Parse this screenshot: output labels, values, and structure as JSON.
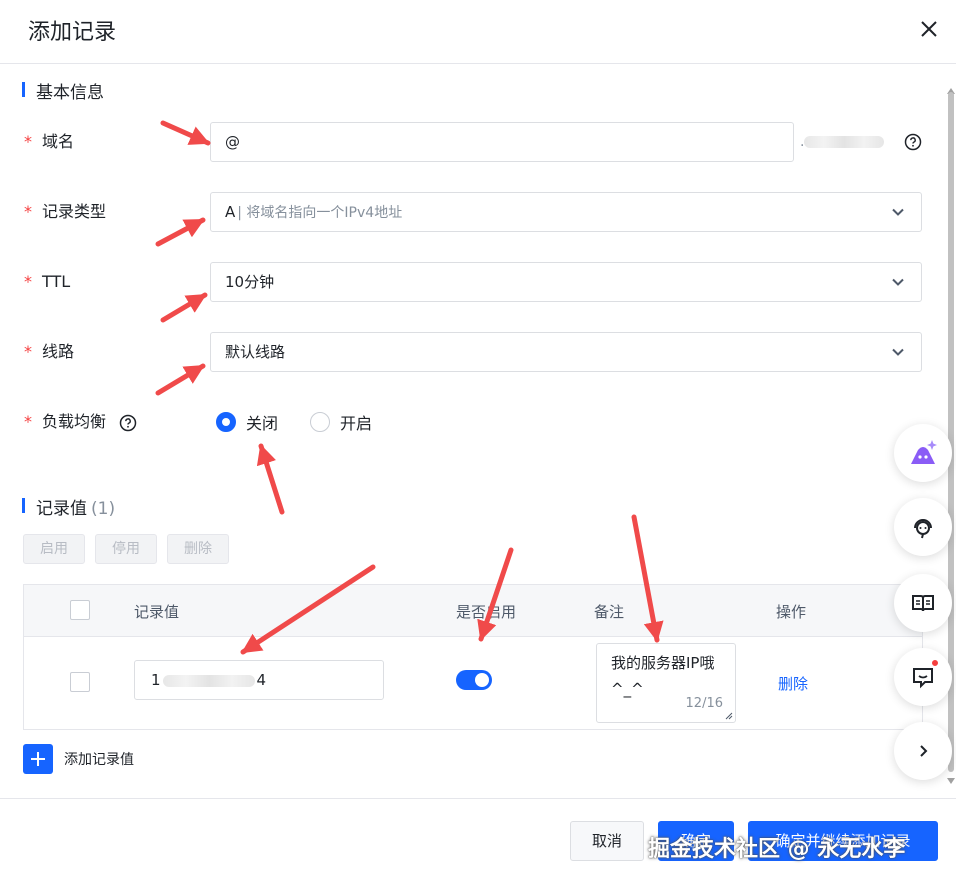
{
  "dialog": {
    "title": "添加记录"
  },
  "basic_section": {
    "title": "基本信息"
  },
  "fields": {
    "domain": {
      "label": "域名",
      "value": "@",
      "suffix": "."
    },
    "record_type": {
      "label": "记录类型",
      "value": "A",
      "hint": "| 将域名指向一个IPv4地址"
    },
    "ttl": {
      "label": "TTL",
      "value": "10分钟"
    },
    "line": {
      "label": "线路",
      "value": "默认线路"
    },
    "load_balance": {
      "label": "负载均衡",
      "options": [
        "关闭",
        "开启"
      ],
      "selected": "关闭"
    }
  },
  "records_section": {
    "title": "记录值",
    "count": "(1)"
  },
  "batch_actions": [
    "启用",
    "停用",
    "删除"
  ],
  "table": {
    "columns": [
      "记录值",
      "是否启用",
      "备注",
      "操作"
    ],
    "rows": [
      {
        "value_start": "1",
        "value_end": "4",
        "enabled": true,
        "note": "我的服务器IP哦 ^_^",
        "note_count": "12/16",
        "action": "删除"
      }
    ]
  },
  "add_record_label": "添加记录值",
  "footer": {
    "cancel": "取消",
    "confirm": "确定",
    "confirm_continue": "确定并继续添加记录"
  },
  "watermark": "掘金技术社区 @ 永无水李",
  "colors": {
    "primary": "#1664ff",
    "required": "#f53f3f",
    "annotation_arrow": "#f04a4a"
  },
  "icons": [
    "close-icon",
    "help-icon",
    "chevron-down-icon",
    "ai-assistant-icon",
    "customer-service-icon",
    "docs-icon",
    "feedback-icon",
    "chevron-right-icon"
  ]
}
